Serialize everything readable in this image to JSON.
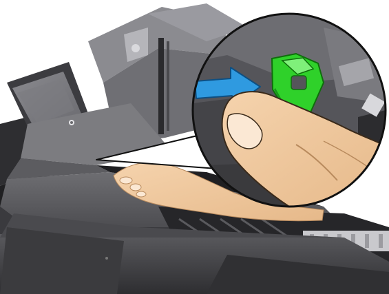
{
  "illustration": {
    "subject": "printer-service-step",
    "callout": {
      "arrow_color": "#2f9ae0",
      "latch_color": "#2fd12a"
    },
    "colors": {
      "printer_body": "#5f5f63",
      "printer_dark": "#3a3a3e",
      "skin": "#efc79c",
      "background": "#ffffff"
    }
  }
}
